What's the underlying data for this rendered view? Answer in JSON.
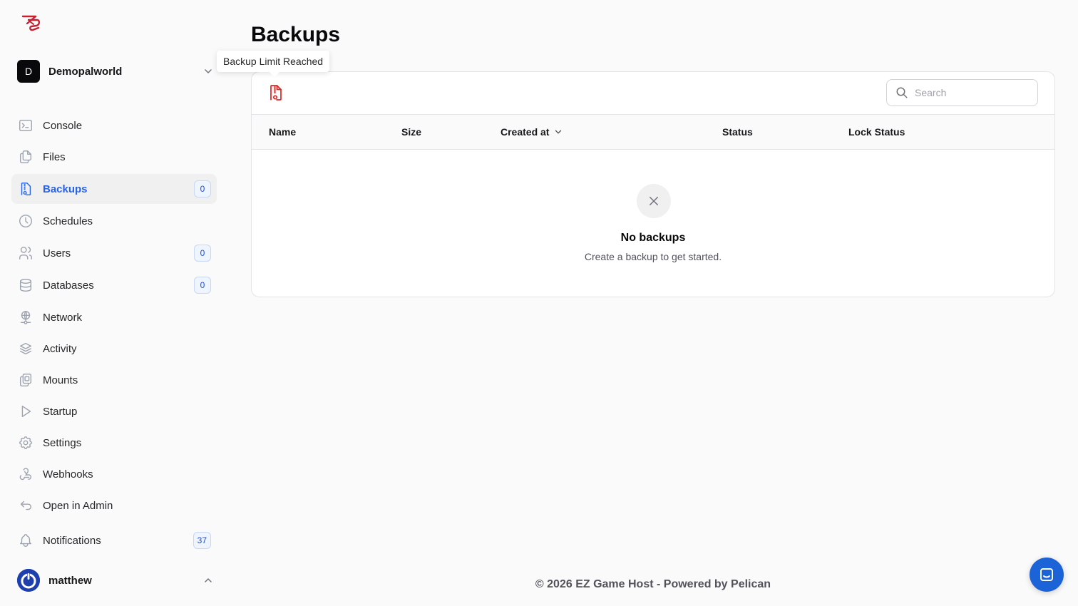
{
  "sidebar": {
    "server": {
      "initial": "D",
      "name": "Demopalworld"
    },
    "items": [
      {
        "label": "Console",
        "icon": "terminal-icon"
      },
      {
        "label": "Files",
        "icon": "files-icon"
      },
      {
        "label": "Backups",
        "icon": "file-zip-icon",
        "badge": "0",
        "active": true
      },
      {
        "label": "Schedules",
        "icon": "clock-icon"
      },
      {
        "label": "Users",
        "icon": "users-icon",
        "badge": "0"
      },
      {
        "label": "Databases",
        "icon": "database-icon",
        "badge": "0"
      },
      {
        "label": "Network",
        "icon": "network-icon"
      },
      {
        "label": "Activity",
        "icon": "stack-icon"
      },
      {
        "label": "Mounts",
        "icon": "mounts-icon"
      },
      {
        "label": "Startup",
        "icon": "play-icon"
      },
      {
        "label": "Settings",
        "icon": "gear-icon"
      },
      {
        "label": "Webhooks",
        "icon": "webhook-icon"
      },
      {
        "label": "Open in Admin",
        "icon": "arrow-back-icon"
      },
      {
        "label": "Notifications",
        "icon": "bell-icon",
        "badge": "37"
      }
    ],
    "user": {
      "name": "matthew"
    }
  },
  "page": {
    "title": "Backups",
    "tooltip": "Backup Limit Reached"
  },
  "search": {
    "placeholder": "Search"
  },
  "table": {
    "columns": [
      "Name",
      "Size",
      "Created at",
      "Status",
      "Lock Status"
    ],
    "sorted_column": "Created at"
  },
  "empty": {
    "title": "No backups",
    "description": "Create a backup to get started."
  },
  "footer": {
    "text": "© 2026 EZ Game Host - Powered by Pelican"
  },
  "colors": {
    "accent": "#2563eb",
    "danger": "#dc2626",
    "chat": "#1d63d8"
  }
}
